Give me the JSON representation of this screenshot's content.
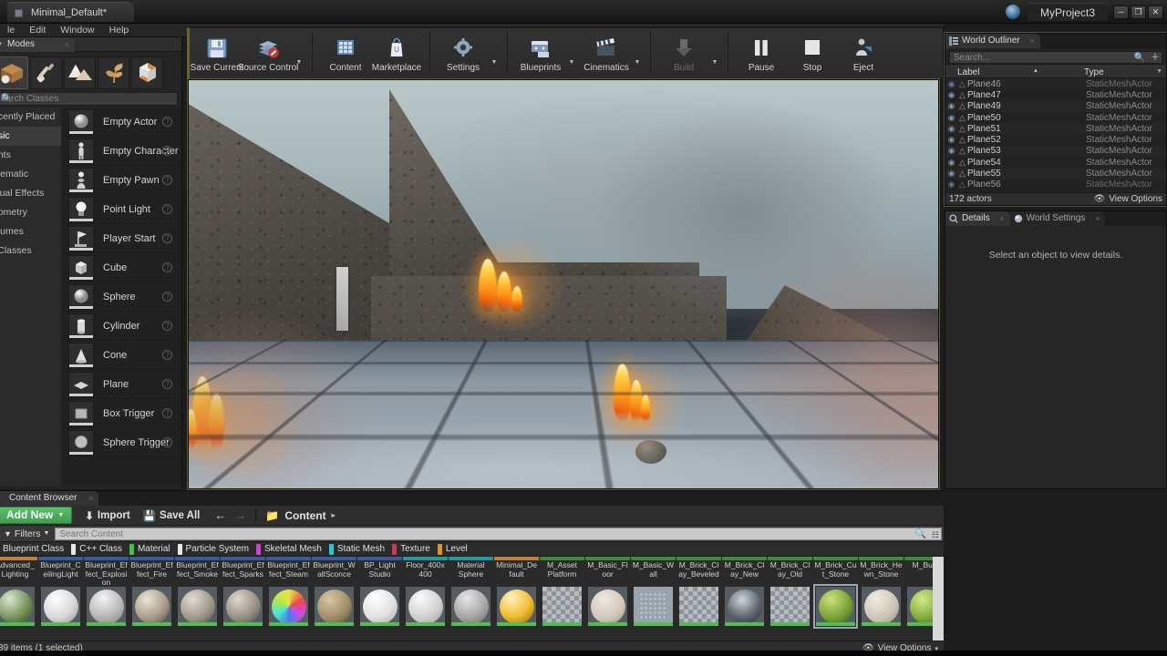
{
  "window": {
    "level_tab": "Minimal_Default*",
    "project_tab": "MyProject3",
    "minimize": "─",
    "maximize": "❐",
    "close": "✕"
  },
  "menubar": {
    "items": [
      "le",
      "Edit",
      "Window",
      "Help"
    ]
  },
  "modes": {
    "tab_label": "Modes",
    "close_x": "×",
    "mode_icons": [
      {
        "name": "place-mode",
        "selected": false
      },
      {
        "name": "paint-mode",
        "selected": false
      },
      {
        "name": "landscape-mode",
        "selected": false
      },
      {
        "name": "foliage-mode",
        "selected": false
      },
      {
        "name": "geometry-editing-mode",
        "selected": false
      }
    ],
    "search_placeholder": "earch Classes",
    "categories": [
      {
        "label": "ecently Placed",
        "selected": false
      },
      {
        "label": "asic",
        "selected": true
      },
      {
        "label": "ghts",
        "selected": false
      },
      {
        "label": "inematic",
        "selected": false
      },
      {
        "label": "isual Effects",
        "selected": false
      },
      {
        "label": "eometry",
        "selected": false
      },
      {
        "label": "olumes",
        "selected": false
      },
      {
        "label": "l Classes",
        "selected": false
      }
    ],
    "assets": [
      {
        "label": "Empty Actor",
        "icon": "sphere-icon"
      },
      {
        "label": "Empty Character",
        "icon": "character-icon"
      },
      {
        "label": "Empty Pawn",
        "icon": "pawn-icon"
      },
      {
        "label": "Point Light",
        "icon": "bulb-icon"
      },
      {
        "label": "Player Start",
        "icon": "flag-icon"
      },
      {
        "label": "Cube",
        "icon": "cube-icon"
      },
      {
        "label": "Sphere",
        "icon": "sphere-icon"
      },
      {
        "label": "Cylinder",
        "icon": "cylinder-icon"
      },
      {
        "label": "Cone",
        "icon": "cone-icon"
      },
      {
        "label": "Plane",
        "icon": "plane-icon"
      },
      {
        "label": "Box Trigger",
        "icon": "box-trigger-icon"
      },
      {
        "label": "Sphere Trigger",
        "icon": "sphere-trigger-icon"
      }
    ],
    "help_glyph": "?"
  },
  "toolbar": {
    "buttons": [
      {
        "label": "Save Current",
        "icon": "floppy-disk-icon",
        "caret": false,
        "disabled": false
      },
      {
        "label": "Source Control",
        "icon": "source-control-icon",
        "caret": true,
        "disabled": false
      },
      {
        "label": "Content",
        "icon": "content-grid-icon",
        "caret": false,
        "disabled": false
      },
      {
        "label": "Marketplace",
        "icon": "marketplace-bag-icon",
        "caret": false,
        "disabled": false
      },
      {
        "label": "Settings",
        "icon": "gear-icon",
        "caret": true,
        "disabled": false
      },
      {
        "label": "Blueprints",
        "icon": "blueprint-icon",
        "caret": true,
        "disabled": false
      },
      {
        "label": "Cinematics",
        "icon": "clapperboard-icon",
        "caret": true,
        "disabled": false
      },
      {
        "label": "Build",
        "icon": "build-icon",
        "caret": true,
        "disabled": true
      },
      {
        "label": "Pause",
        "icon": "pause-icon",
        "caret": false,
        "disabled": false
      },
      {
        "label": "Stop",
        "icon": "stop-icon",
        "caret": false,
        "disabled": false
      },
      {
        "label": "Eject",
        "icon": "eject-icon",
        "caret": false,
        "disabled": false
      }
    ],
    "caret_glyph": "▼"
  },
  "outliner": {
    "tab_label": "World Outliner",
    "close_x": "×",
    "search_placeholder": "Search...",
    "search_icon": "magnifier-icon",
    "add_icon": "plus-icon",
    "columns": {
      "label": "Label",
      "type": "Type"
    },
    "sort_arrow": "▲",
    "filter_glyph": "▼",
    "rows": [
      {
        "label": "Plane46",
        "type": "StaticMeshActor"
      },
      {
        "label": "Plane47",
        "type": "StaticMeshActor"
      },
      {
        "label": "Plane49",
        "type": "StaticMeshActor"
      },
      {
        "label": "Plane50",
        "type": "StaticMeshActor"
      },
      {
        "label": "Plane51",
        "type": "StaticMeshActor"
      },
      {
        "label": "Plane52",
        "type": "StaticMeshActor"
      },
      {
        "label": "Plane53",
        "type": "StaticMeshActor"
      },
      {
        "label": "Plane54",
        "type": "StaticMeshActor"
      },
      {
        "label": "Plane55",
        "type": "StaticMeshActor"
      },
      {
        "label": "Plane56",
        "type": "StaticMeshActor"
      }
    ],
    "actor_count": "172 actors",
    "view_options": "View Options",
    "eye_glyph": "◉"
  },
  "details": {
    "tab_details": "Details",
    "tab_world_settings": "World Settings",
    "close_x": "×",
    "empty_message": "Select an object to view details."
  },
  "content_browser": {
    "tab_label": "Content Browser",
    "close_x": "×",
    "add_new": "Add New",
    "add_new_caret": "▼",
    "import": "Import",
    "save_all": "Save All",
    "back_arrow": "←",
    "forward_arrow": "→",
    "breadcrumb_root": "Content",
    "breadcrumb_caret": "▸",
    "filters": "Filters",
    "filters_caret": "▼",
    "search_placeholder": "Search Content",
    "type_chips": [
      {
        "label": "Blueprint Class",
        "color": "#3d6fc4"
      },
      {
        "label": "C++ Class",
        "color": "#e8e8e8"
      },
      {
        "label": "Material",
        "color": "#3fc43f"
      },
      {
        "label": "Particle System",
        "color": "#e8e8e8"
      },
      {
        "label": "Skeletal Mesh",
        "color": "#d23fd2"
      },
      {
        "label": "Static Mesh",
        "color": "#25c9d0"
      },
      {
        "label": "Texture",
        "color": "#c43d4e"
      },
      {
        "label": "Level",
        "color": "#e0952a"
      }
    ],
    "assets": [
      {
        "name": "Advanced_Lighting",
        "bar": "#c0832a",
        "thumb": "mossy-sphere",
        "selected": false
      },
      {
        "name": "Blueprint_CeilingLight",
        "bar": "#3d5a9e",
        "thumb": "white-sphere",
        "selected": false
      },
      {
        "name": "Blueprint_Effect_Explosion",
        "bar": "#3d5a9e",
        "thumb": "grey-sphere",
        "selected": false
      },
      {
        "name": "Blueprint_Effect_Fire",
        "bar": "#3d5a9e",
        "thumb": "stone-sphere",
        "selected": false
      },
      {
        "name": "Blueprint_Effect_Smoke",
        "bar": "#3d5a9e",
        "thumb": "stone-sphere",
        "selected": false
      },
      {
        "name": "Blueprint_Effect_Sparks",
        "bar": "#3d5a9e",
        "thumb": "stone-sphere",
        "selected": false
      },
      {
        "name": "Blueprint_Effect_Steam",
        "bar": "#3d5a9e",
        "thumb": "color-sphere",
        "selected": false
      },
      {
        "name": "Blueprint_WallSconce",
        "bar": "#3d5a9e",
        "thumb": "sand-sphere",
        "selected": false
      },
      {
        "name": "BP_Light Studio",
        "bar": "#3d5a9e",
        "thumb": "white-sphere",
        "selected": false
      },
      {
        "name": "Floor_400x400",
        "bar": "#1f9aa0",
        "thumb": "white-sphere",
        "selected": false
      },
      {
        "name": "Material Sphere",
        "bar": "#1f9aa0",
        "thumb": "grey-sphere",
        "selected": false
      },
      {
        "name": "Minimal_Default",
        "bar": "#c0832a",
        "thumb": "gold-sphere",
        "selected": false
      },
      {
        "name": "M_Asset Platform",
        "bar": "#3f8a3f",
        "thumb": "checker",
        "selected": false
      },
      {
        "name": "M_Basic_Floor",
        "bar": "#3f8a3f",
        "thumb": "brain-sphere",
        "selected": false
      },
      {
        "name": "M_Basic_Wall",
        "bar": "#3f8a3f",
        "thumb": "dots",
        "selected": false
      },
      {
        "name": "M_Brick_Clay_Beveled",
        "bar": "#3f8a3f",
        "thumb": "checker",
        "selected": false
      },
      {
        "name": "M_Brick_Clay_New",
        "bar": "#3f8a3f",
        "thumb": "dark-sphere",
        "selected": false
      },
      {
        "name": "M_Brick_Clay_Old",
        "bar": "#3f8a3f",
        "thumb": "checker",
        "selected": false
      },
      {
        "name": "M_Brick_Cut_Stone",
        "bar": "#3f8a3f",
        "thumb": "moss-sphere",
        "selected": true
      },
      {
        "name": "M_Brick_Hewn_Stone",
        "bar": "#3f8a3f",
        "thumb": "sand-sphere",
        "selected": false
      },
      {
        "name": "M_Burst",
        "bar": "#3f8a3f",
        "thumb": "moss-sphere",
        "selected": false
      }
    ],
    "status": "39 items (1 selected)",
    "view_options": "View Options",
    "view_options_caret": "▾"
  }
}
